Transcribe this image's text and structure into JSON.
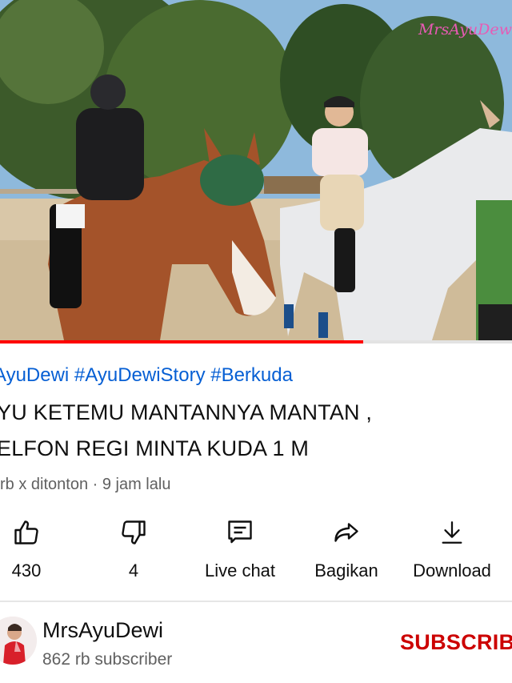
{
  "video": {
    "watermark": "MrsAyuDewi",
    "progress_fraction": 0.71
  },
  "hashtags": "AyuDewi #AyuDewiStory #Berkuda",
  "title": {
    "line1": "YU KETEMU MANTANNYA MANTAN ,",
    "line2": "ELFON REGI MINTA KUDA 1 M"
  },
  "meta": "rb x ditonton · 9 jam lalu",
  "actions": [
    {
      "label": "430",
      "icon": "thumbs-up-icon"
    },
    {
      "label": "4",
      "icon": "thumbs-down-icon"
    },
    {
      "label": "Live chat",
      "icon": "live-chat-icon"
    },
    {
      "label": "Bagikan",
      "icon": "share-icon"
    },
    {
      "label": "Download",
      "icon": "download-icon"
    }
  ],
  "channel": {
    "name": "MrsAyuDewi",
    "subscribers": "862 rb subscriber",
    "subscribe_label": "SUBSCRIBE"
  },
  "colors": {
    "link_blue": "#065fd4",
    "subscribe_red": "#cc0000",
    "progress_red": "#ff0000",
    "secondary_text": "#606060"
  }
}
